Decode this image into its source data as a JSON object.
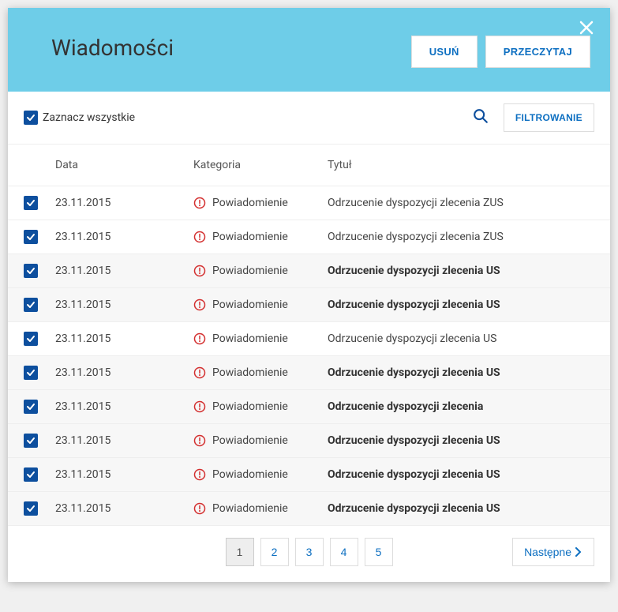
{
  "header": {
    "title": "Wiadomości",
    "delete_label": "USUŃ",
    "read_label": "PRZECZYTAJ"
  },
  "toolbar": {
    "select_all_label": "Zaznacz wszystkie",
    "filter_label": "FILTROWANIE"
  },
  "columns": {
    "date": "Data",
    "category": "Kategoria",
    "title": "Tytuł"
  },
  "rows": [
    {
      "date": "23.11.2015",
      "category": "Powiadomienie",
      "title": "Odrzucenie dyspozycji zlecenia ZUS",
      "bold": false,
      "alt": false
    },
    {
      "date": "23.11.2015",
      "category": "Powiadomienie",
      "title": "Odrzucenie dyspozycji zlecenia ZUS",
      "bold": false,
      "alt": false
    },
    {
      "date": "23.11.2015",
      "category": "Powiadomienie",
      "title": "Odrzucenie dyspozycji zlecenia US",
      "bold": true,
      "alt": true
    },
    {
      "date": "23.11.2015",
      "category": "Powiadomienie",
      "title": "Odrzucenie dyspozycji zlecenia US",
      "bold": true,
      "alt": true
    },
    {
      "date": "23.11.2015",
      "category": "Powiadomienie",
      "title": "Odrzucenie dyspozycji zlecenia US",
      "bold": false,
      "alt": false
    },
    {
      "date": "23.11.2015",
      "category": "Powiadomienie",
      "title": "Odrzucenie dyspozycji zlecenia US",
      "bold": true,
      "alt": true
    },
    {
      "date": "23.11.2015",
      "category": "Powiadomienie",
      "title": "Odrzucenie dyspozycji zlecenia",
      "bold": true,
      "alt": true
    },
    {
      "date": "23.11.2015",
      "category": "Powiadomienie",
      "title": "Odrzucenie dyspozycji zlecenia US",
      "bold": true,
      "alt": true
    },
    {
      "date": "23.11.2015",
      "category": "Powiadomienie",
      "title": "Odrzucenie dyspozycji zlecenia US",
      "bold": true,
      "alt": true
    },
    {
      "date": "23.11.2015",
      "category": "Powiadomienie",
      "title": "Odrzucenie dyspozycji zlecenia US",
      "bold": true,
      "alt": true
    }
  ],
  "pagination": {
    "pages": [
      "1",
      "2",
      "3",
      "4",
      "5"
    ],
    "active": "1",
    "next_label": "Następne"
  }
}
